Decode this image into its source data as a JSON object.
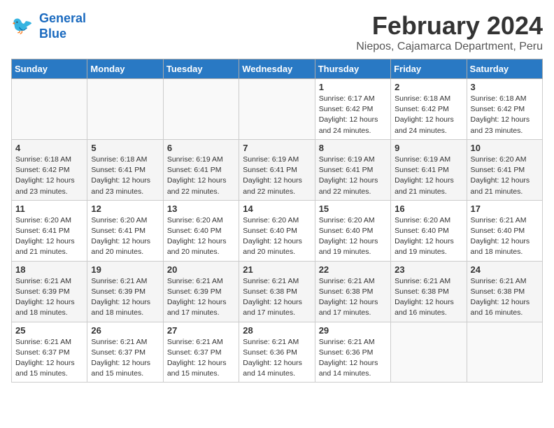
{
  "logo": {
    "line1": "General",
    "line2": "Blue"
  },
  "title": "February 2024",
  "subtitle": "Niepos, Cajamarca Department, Peru",
  "days_of_week": [
    "Sunday",
    "Monday",
    "Tuesday",
    "Wednesday",
    "Thursday",
    "Friday",
    "Saturday"
  ],
  "weeks": [
    [
      {
        "day": "",
        "info": ""
      },
      {
        "day": "",
        "info": ""
      },
      {
        "day": "",
        "info": ""
      },
      {
        "day": "",
        "info": ""
      },
      {
        "day": "1",
        "info": "Sunrise: 6:17 AM\nSunset: 6:42 PM\nDaylight: 12 hours\nand 24 minutes."
      },
      {
        "day": "2",
        "info": "Sunrise: 6:18 AM\nSunset: 6:42 PM\nDaylight: 12 hours\nand 24 minutes."
      },
      {
        "day": "3",
        "info": "Sunrise: 6:18 AM\nSunset: 6:42 PM\nDaylight: 12 hours\nand 23 minutes."
      }
    ],
    [
      {
        "day": "4",
        "info": "Sunrise: 6:18 AM\nSunset: 6:42 PM\nDaylight: 12 hours\nand 23 minutes."
      },
      {
        "day": "5",
        "info": "Sunrise: 6:18 AM\nSunset: 6:41 PM\nDaylight: 12 hours\nand 23 minutes."
      },
      {
        "day": "6",
        "info": "Sunrise: 6:19 AM\nSunset: 6:41 PM\nDaylight: 12 hours\nand 22 minutes."
      },
      {
        "day": "7",
        "info": "Sunrise: 6:19 AM\nSunset: 6:41 PM\nDaylight: 12 hours\nand 22 minutes."
      },
      {
        "day": "8",
        "info": "Sunrise: 6:19 AM\nSunset: 6:41 PM\nDaylight: 12 hours\nand 22 minutes."
      },
      {
        "day": "9",
        "info": "Sunrise: 6:19 AM\nSunset: 6:41 PM\nDaylight: 12 hours\nand 21 minutes."
      },
      {
        "day": "10",
        "info": "Sunrise: 6:20 AM\nSunset: 6:41 PM\nDaylight: 12 hours\nand 21 minutes."
      }
    ],
    [
      {
        "day": "11",
        "info": "Sunrise: 6:20 AM\nSunset: 6:41 PM\nDaylight: 12 hours\nand 21 minutes."
      },
      {
        "day": "12",
        "info": "Sunrise: 6:20 AM\nSunset: 6:41 PM\nDaylight: 12 hours\nand 20 minutes."
      },
      {
        "day": "13",
        "info": "Sunrise: 6:20 AM\nSunset: 6:40 PM\nDaylight: 12 hours\nand 20 minutes."
      },
      {
        "day": "14",
        "info": "Sunrise: 6:20 AM\nSunset: 6:40 PM\nDaylight: 12 hours\nand 20 minutes."
      },
      {
        "day": "15",
        "info": "Sunrise: 6:20 AM\nSunset: 6:40 PM\nDaylight: 12 hours\nand 19 minutes."
      },
      {
        "day": "16",
        "info": "Sunrise: 6:20 AM\nSunset: 6:40 PM\nDaylight: 12 hours\nand 19 minutes."
      },
      {
        "day": "17",
        "info": "Sunrise: 6:21 AM\nSunset: 6:40 PM\nDaylight: 12 hours\nand 18 minutes."
      }
    ],
    [
      {
        "day": "18",
        "info": "Sunrise: 6:21 AM\nSunset: 6:39 PM\nDaylight: 12 hours\nand 18 minutes."
      },
      {
        "day": "19",
        "info": "Sunrise: 6:21 AM\nSunset: 6:39 PM\nDaylight: 12 hours\nand 18 minutes."
      },
      {
        "day": "20",
        "info": "Sunrise: 6:21 AM\nSunset: 6:39 PM\nDaylight: 12 hours\nand 17 minutes."
      },
      {
        "day": "21",
        "info": "Sunrise: 6:21 AM\nSunset: 6:38 PM\nDaylight: 12 hours\nand 17 minutes."
      },
      {
        "day": "22",
        "info": "Sunrise: 6:21 AM\nSunset: 6:38 PM\nDaylight: 12 hours\nand 17 minutes."
      },
      {
        "day": "23",
        "info": "Sunrise: 6:21 AM\nSunset: 6:38 PM\nDaylight: 12 hours\nand 16 minutes."
      },
      {
        "day": "24",
        "info": "Sunrise: 6:21 AM\nSunset: 6:38 PM\nDaylight: 12 hours\nand 16 minutes."
      }
    ],
    [
      {
        "day": "25",
        "info": "Sunrise: 6:21 AM\nSunset: 6:37 PM\nDaylight: 12 hours\nand 15 minutes."
      },
      {
        "day": "26",
        "info": "Sunrise: 6:21 AM\nSunset: 6:37 PM\nDaylight: 12 hours\nand 15 minutes."
      },
      {
        "day": "27",
        "info": "Sunrise: 6:21 AM\nSunset: 6:37 PM\nDaylight: 12 hours\nand 15 minutes."
      },
      {
        "day": "28",
        "info": "Sunrise: 6:21 AM\nSunset: 6:36 PM\nDaylight: 12 hours\nand 14 minutes."
      },
      {
        "day": "29",
        "info": "Sunrise: 6:21 AM\nSunset: 6:36 PM\nDaylight: 12 hours\nand 14 minutes."
      },
      {
        "day": "",
        "info": ""
      },
      {
        "day": "",
        "info": ""
      }
    ]
  ]
}
